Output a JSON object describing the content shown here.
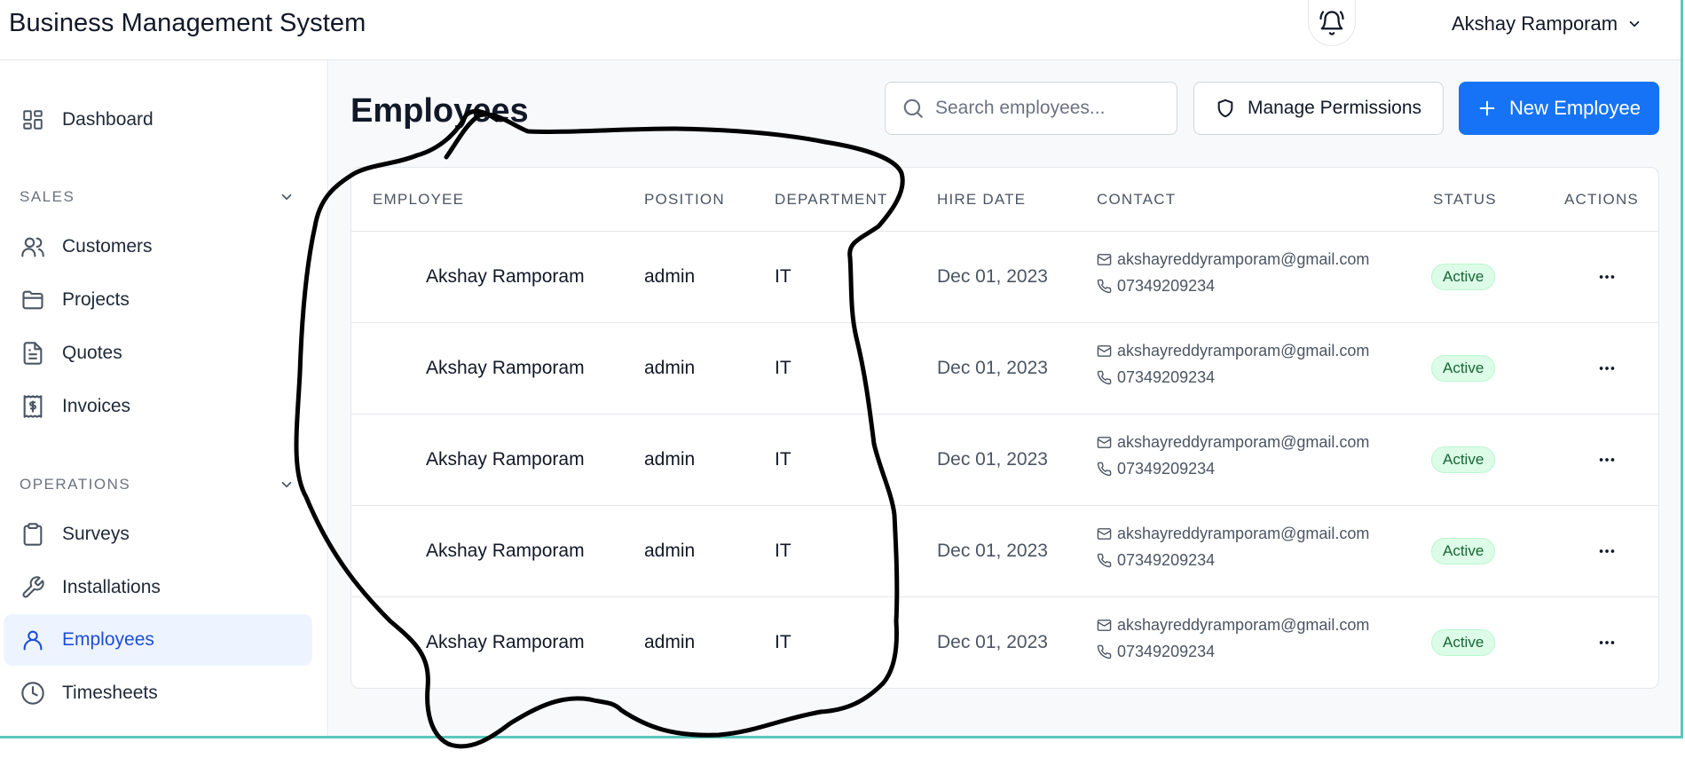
{
  "header": {
    "title": "Business Management System",
    "user_name": "Akshay Ramporam"
  },
  "sidebar": {
    "dashboard": "Dashboard",
    "sections": [
      {
        "label": "SALES",
        "items": [
          "Customers",
          "Projects",
          "Quotes",
          "Invoices"
        ]
      },
      {
        "label": "OPERATIONS",
        "items": [
          "Surveys",
          "Installations",
          "Employees",
          "Timesheets"
        ]
      }
    ],
    "active_item": "Employees"
  },
  "main": {
    "title": "Employees",
    "search_placeholder": "Search employees...",
    "manage_permissions_label": "Manage Permissions",
    "new_employee_label": "New Employee",
    "table": {
      "columns": [
        "EMPLOYEE",
        "POSITION",
        "DEPARTMENT",
        "HIRE DATE",
        "CONTACT",
        "STATUS",
        "ACTIONS"
      ],
      "rows": [
        {
          "name": "Akshay Ramporam",
          "position": "admin",
          "department": "IT",
          "hire_date": "Dec 01, 2023",
          "email": "akshayreddyramporam@gmail.com",
          "phone": "07349209234",
          "status": "Active"
        },
        {
          "name": "Akshay Ramporam",
          "position": "admin",
          "department": "IT",
          "hire_date": "Dec 01, 2023",
          "email": "akshayreddyramporam@gmail.com",
          "phone": "07349209234",
          "status": "Active"
        },
        {
          "name": "Akshay Ramporam",
          "position": "admin",
          "department": "IT",
          "hire_date": "Dec 01, 2023",
          "email": "akshayreddyramporam@gmail.com",
          "phone": "07349209234",
          "status": "Active"
        },
        {
          "name": "Akshay Ramporam",
          "position": "admin",
          "department": "IT",
          "hire_date": "Dec 01, 2023",
          "email": "akshayreddyramporam@gmail.com",
          "phone": "07349209234",
          "status": "Active"
        },
        {
          "name": "Akshay Ramporam",
          "position": "admin",
          "department": "IT",
          "hire_date": "Dec 01, 2023",
          "email": "akshayreddyramporam@gmail.com",
          "phone": "07349209234",
          "status": "Active"
        }
      ]
    }
  },
  "colors": {
    "accent": "#1673f5",
    "active_nav_bg": "#eef4ff",
    "status_active_bg": "#dcfce7",
    "status_active_text": "#166534",
    "annotation_stroke": "#000000",
    "window_border": "#5cc7bd"
  },
  "icons": {
    "notifications": "bell-icon",
    "user_menu": "chevron-down-icon",
    "search": "search-icon",
    "permissions": "shield-icon",
    "new": "plus-icon",
    "row_actions": "more-horizontal-icon"
  }
}
